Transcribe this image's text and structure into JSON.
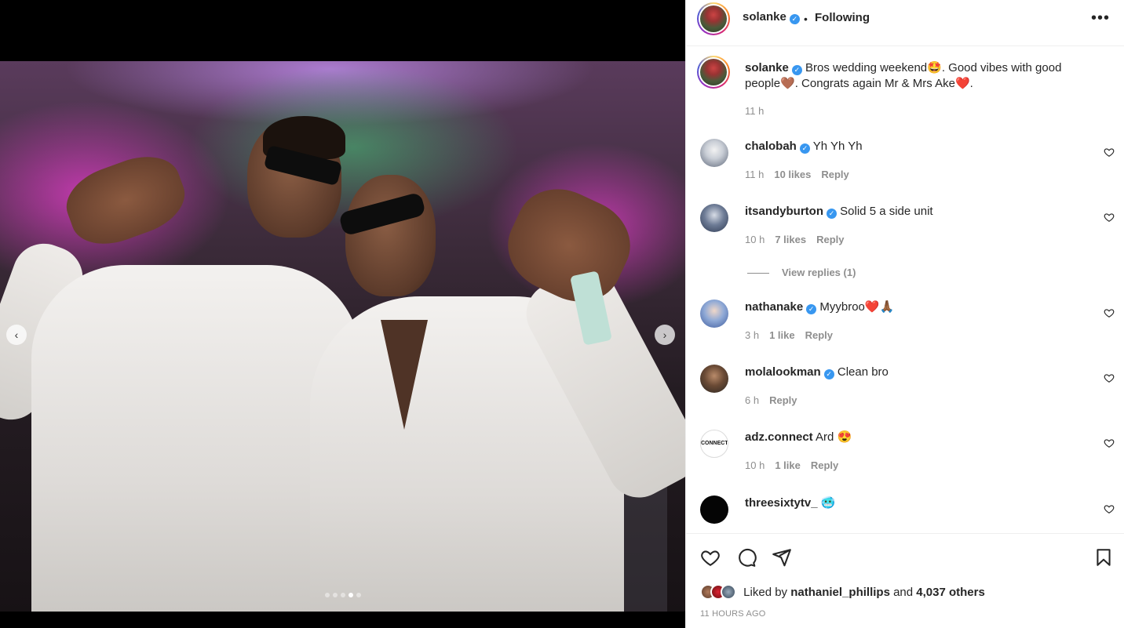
{
  "post": {
    "author": "solanke",
    "following_label": "Following",
    "separator": "•",
    "more_icon": "more-horizontal-icon"
  },
  "caption": {
    "username": "solanke",
    "text": "Bros wedding weekend🤩. Good vibes with good people🤎. Congrats again Mr & Mrs Ake❤️.",
    "time": "11 h"
  },
  "comments": [
    {
      "username": "chalobah",
      "text": "Yh Yh Yh",
      "time": "11 h",
      "likes": "10 likes",
      "reply": "Reply"
    },
    {
      "username": "itsandyburton",
      "text": "Solid 5 a side unit",
      "time": "10 h",
      "likes": "7 likes",
      "reply": "Reply"
    },
    {
      "username": "nathanake",
      "text": "Myybroo❤️🙏🏾",
      "time": "3 h",
      "likes": "1 like",
      "reply": "Reply"
    },
    {
      "username": "molalookman",
      "text": "Clean bro",
      "time": "6 h",
      "likes": "",
      "reply": "Reply"
    },
    {
      "username": "adz.connect",
      "text": "Ard 😍",
      "time": "10 h",
      "likes": "1 like",
      "reply": "Reply",
      "avatar_text": "CONNECT"
    },
    {
      "username": "threesixtytv_",
      "text": "🥶"
    }
  ],
  "view_replies": "View replies (1)",
  "carousel": {
    "total": 5,
    "active": 3
  },
  "footer": {
    "liked_by_prefix": "Liked by",
    "liked_by_user": "nathaniel_phillips",
    "liked_by_and": "and",
    "liked_by_others": "4,037 others",
    "time_ago": "11 HOURS AGO"
  },
  "colors": {
    "verified": "#3897f0",
    "meta": "#8e8e8e",
    "text": "#262626"
  }
}
